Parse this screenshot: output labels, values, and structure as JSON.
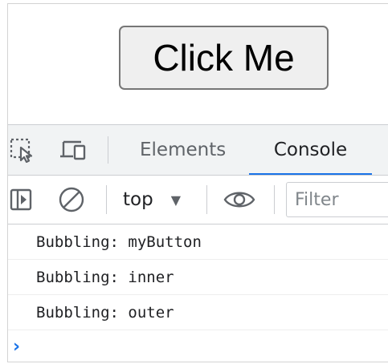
{
  "page": {
    "button_label": "Click Me"
  },
  "devtools": {
    "tabs": [
      {
        "label": "Elements",
        "active": false
      },
      {
        "label": "Console",
        "active": true
      }
    ],
    "toolbar": {
      "context": "top",
      "filter_placeholder": "Filter"
    },
    "console": {
      "messages": [
        "Bubbling: myButton",
        "Bubbling: inner",
        "Bubbling: outer"
      ],
      "prompt_symbol": "›"
    },
    "icons": {
      "inspect": "inspect-element-icon",
      "device": "device-toolbar-icon",
      "sidebar": "show-sidebar-icon",
      "clear": "clear-console-icon",
      "eye": "live-expression-eye-icon",
      "dropdown": "chevron-down-icon"
    },
    "colors": {
      "accent": "#1a73e8",
      "toolbar_bg": "#f1f3f4",
      "border": "#cbcdd1"
    }
  }
}
